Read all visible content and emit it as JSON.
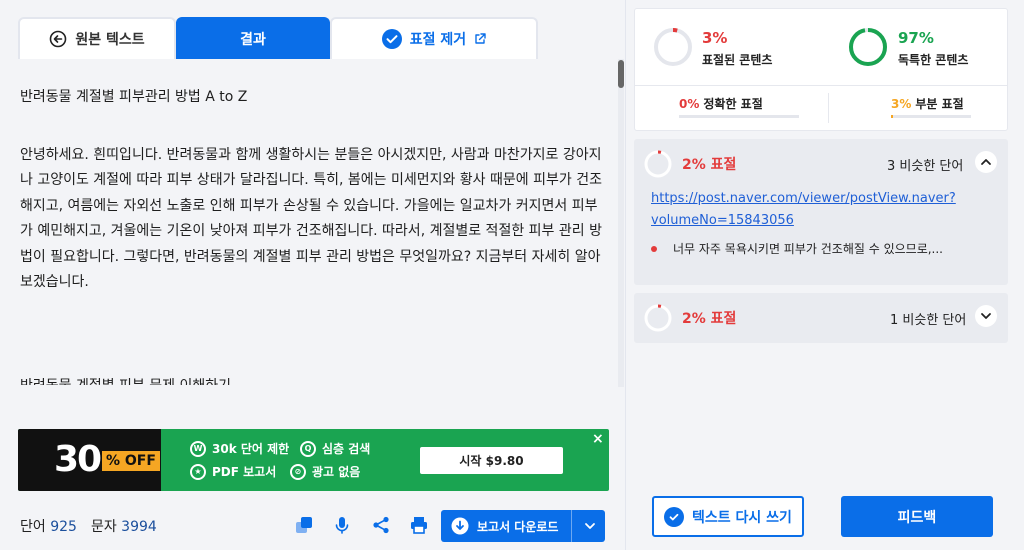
{
  "tabs": {
    "original": "원본 텍스트",
    "result": "결과",
    "remove": "표절 제거"
  },
  "document": {
    "title": "반려동물 계절별 피부관리 방법 A to Z",
    "body": "안녕하세요. 흰띠입니다. 반려동물과 함께 생활하시는 분들은 아시겠지만, 사람과 마찬가지로 강아지나 고양이도 계절에 따라 피부 상태가 달라집니다. 특히, 봄에는 미세먼지와 황사 때문에 피부가 건조해지고, 여름에는 자외선 노출로 인해 피부가 손상될 수 있습니다. 가을에는 일교차가 커지면서 피부가 예민해지고, 겨울에는 기온이 낮아져 피부가 건조해집니다. 따라서, 계절별로 적절한 피부 관리 방법이 필요합니다. 그렇다면, 반려동물의 계절별 피부 관리 방법은 무엇일까요? 지금부터 자세히 알아보겠습니다.",
    "cutoff": "반려동물 계절별 피부 문제 이해하기"
  },
  "ad": {
    "discount": "30",
    "off": "% OFF",
    "feature_1": "30k 단어 제한",
    "feature_2": "심층 검색",
    "feature_3": "PDF 보고서",
    "feature_4": "광고 없음",
    "cta": "시작 $9.80",
    "close": "×"
  },
  "footer": {
    "words_label": "단어",
    "words_value": "925",
    "chars_label": "문자",
    "chars_value": "3994",
    "download": "보고서 다운로드"
  },
  "summary": {
    "plag_pct": "3%",
    "plag_label": "표절된 콘텐츠",
    "unique_pct": "97%",
    "unique_label": "독특한 콘텐츠",
    "exact_pct": "0%",
    "exact_label": "정확한 표절",
    "partial_pct": "3%",
    "partial_label": "부분 표절",
    "plag_fraction": 0.03,
    "unique_fraction": 0.97,
    "exact_fraction": 0.0,
    "partial_fraction": 0.03
  },
  "results": [
    {
      "pct": "2% 표절",
      "words": "3 비슷한 단어",
      "url": "https://post.naver.com/viewer/postView.naver?volumeNo=15843056",
      "snippet": "너무 자주 목욕시키면 피부가 건조해질 수 있으므로,...",
      "fraction": 0.02
    },
    {
      "pct": "2% 표절",
      "words": "1 비슷한 단어",
      "fraction": 0.02
    }
  ],
  "actions": {
    "rewrite": "텍스트 다시 쓰기",
    "feedback": "피드백"
  },
  "colors": {
    "accent": "#0a6ee8",
    "plag": "#e33b3b",
    "unique": "#1aa451",
    "partial": "#f5a623"
  }
}
